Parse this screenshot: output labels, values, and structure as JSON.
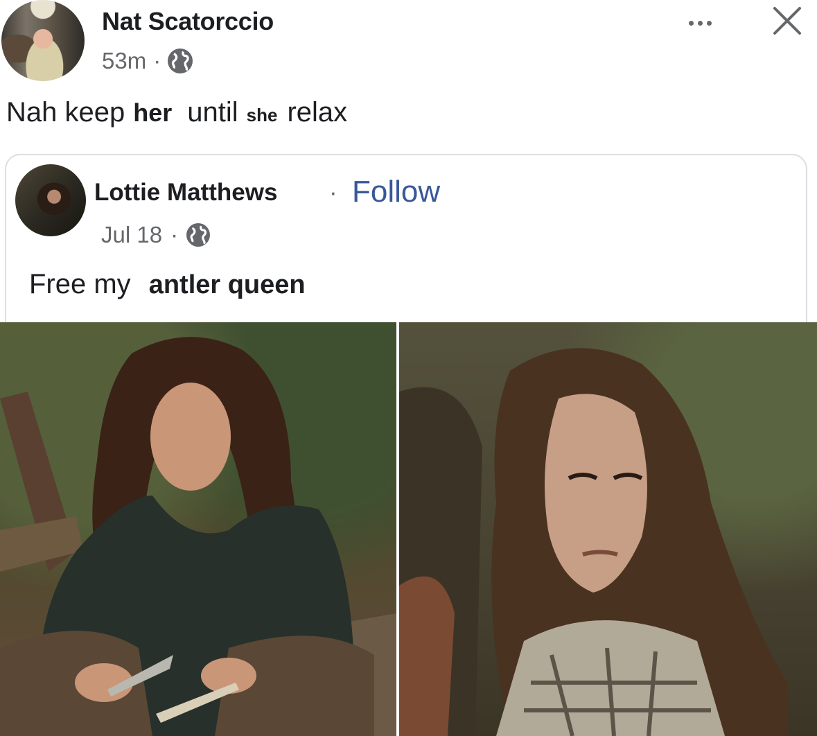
{
  "post": {
    "author": "Nat Scatorccio",
    "time": "53m",
    "separator": "·",
    "text_parts": [
      "Nah keep",
      "her",
      "until",
      "she",
      "relax"
    ]
  },
  "shared_post": {
    "author": "Lottie Matthews",
    "separator": "·",
    "follow_label": "Follow",
    "date": "Jul 18",
    "text_parts": [
      "Free my",
      "antler queen"
    ]
  },
  "colors": {
    "link": "#385898",
    "meta": "#65676b",
    "border": "#dcdee2"
  },
  "icons": {
    "audience": "globe-icon",
    "menu": "more-options-icon",
    "close": "close-icon"
  }
}
